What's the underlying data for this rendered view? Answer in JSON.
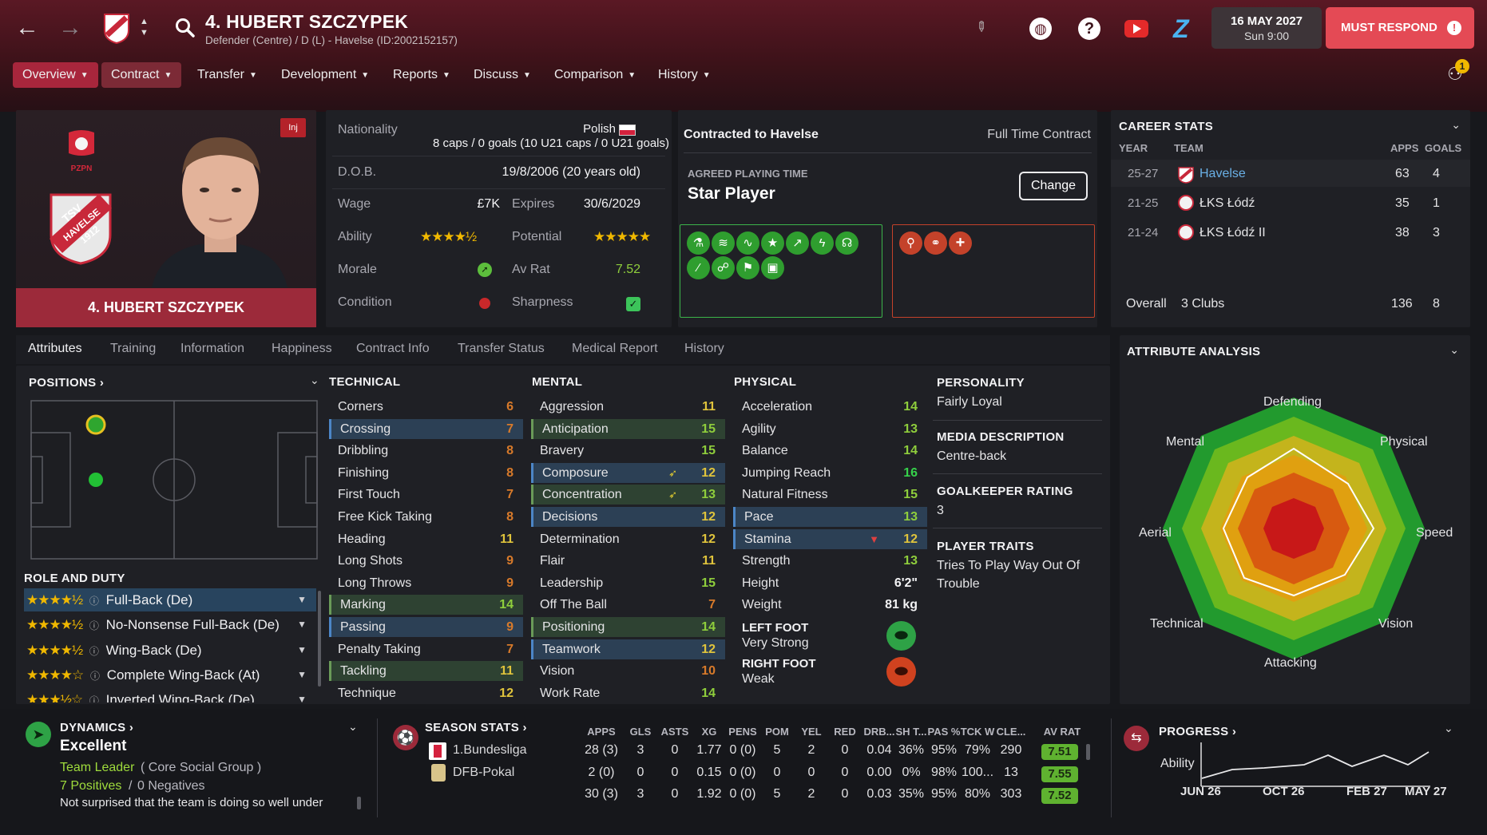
{
  "header": {
    "title": "4. HUBERT SZCZYPEK",
    "subtitle": "Defender (Centre) / D (L) - Havelse (ID:2002152157)",
    "date_line1": "16 MAY 2027",
    "date_line2": "Sun 9:00",
    "must_respond": "MUST RESPOND",
    "notification_count": "1"
  },
  "menu": [
    {
      "label": "Overview"
    },
    {
      "label": "Contract"
    },
    {
      "label": "Transfer"
    },
    {
      "label": "Development"
    },
    {
      "label": "Reports"
    },
    {
      "label": "Discuss"
    },
    {
      "label": "Comparison"
    },
    {
      "label": "History"
    }
  ],
  "profile": {
    "name_plate": "4. HUBERT SZCZYPEK",
    "inj_badge": "Inj",
    "fed_label": "PZPN",
    "club_badge_line1": "TSV",
    "club_badge_line2": "HAVELSE",
    "club_badge_line3": "1912"
  },
  "info": {
    "nationality_label": "Nationality",
    "nationality": "Polish",
    "caps": "8 caps / 0 goals (10 U21 caps / 0 U21 goals)",
    "dob_label": "D.O.B.",
    "dob": "19/8/2006 (20 years old)",
    "wage_label": "Wage",
    "wage": "£7K",
    "expires_label": "Expires",
    "expires": "30/6/2029",
    "ability_label": "Ability",
    "ability_stars": "★★★★½",
    "ability_rating": 4.5,
    "potential_label": "Potential",
    "potential_stars": "★★★★★",
    "potential_rating": 5,
    "morale_label": "Morale",
    "avrat_label": "Av Rat",
    "avrat": "7.52",
    "condition_label": "Condition",
    "sharpness_label": "Sharpness"
  },
  "contract": {
    "title": "Contracted to Havelse",
    "type": "Full Time Contract",
    "playing_time_label": "AGREED PLAYING TIME",
    "playing_time": "Star Player",
    "change_button": "Change"
  },
  "career": {
    "title": "CAREER STATS",
    "headers": [
      "YEAR",
      "TEAM",
      "APPS",
      "GOALS"
    ],
    "rows": [
      {
        "year": "25-27",
        "team": "Havelse",
        "apps": "63",
        "goals": "4"
      },
      {
        "year": "21-25",
        "team": "ŁKS Łódź",
        "apps": "35",
        "goals": "1"
      },
      {
        "year": "21-24",
        "team": "ŁKS Łódź II",
        "apps": "38",
        "goals": "3"
      }
    ],
    "overall_label": "Overall",
    "overall_clubs": "3 Clubs",
    "overall_apps": "136",
    "overall_goals": "8"
  },
  "tabs": [
    "Attributes",
    "Training",
    "Information",
    "Happiness",
    "Contract Info",
    "Transfer Status",
    "Medical Report",
    "History"
  ],
  "positions": {
    "title": "POSITIONS",
    "role_title": "ROLE AND DUTY",
    "roles": [
      {
        "stars": "★★★★½",
        "name": "Full-Back (De)"
      },
      {
        "stars": "★★★★½",
        "name": "No-Nonsense Full-Back (De)"
      },
      {
        "stars": "★★★★½",
        "name": "Wing-Back (De)"
      },
      {
        "stars": "★★★★☆",
        "name": "Complete Wing-Back (At)"
      },
      {
        "stars": "★★★½☆",
        "name": "Inverted Wing-Back (De)"
      }
    ]
  },
  "technical": {
    "title": "TECHNICAL",
    "items": [
      {
        "name": "Corners",
        "value": "6"
      },
      {
        "name": "Crossing",
        "value": "7"
      },
      {
        "name": "Dribbling",
        "value": "8"
      },
      {
        "name": "Finishing",
        "value": "8"
      },
      {
        "name": "First Touch",
        "value": "7"
      },
      {
        "name": "Free Kick Taking",
        "value": "8"
      },
      {
        "name": "Heading",
        "value": "11"
      },
      {
        "name": "Long Shots",
        "value": "9"
      },
      {
        "name": "Long Throws",
        "value": "9"
      },
      {
        "name": "Marking",
        "value": "14"
      },
      {
        "name": "Passing",
        "value": "9"
      },
      {
        "name": "Penalty Taking",
        "value": "7"
      },
      {
        "name": "Tackling",
        "value": "11"
      },
      {
        "name": "Technique",
        "value": "12"
      }
    ]
  },
  "mental": {
    "title": "MENTAL",
    "items": [
      {
        "name": "Aggression",
        "value": "11"
      },
      {
        "name": "Anticipation",
        "value": "15"
      },
      {
        "name": "Bravery",
        "value": "15"
      },
      {
        "name": "Composure",
        "value": "12"
      },
      {
        "name": "Concentration",
        "value": "13"
      },
      {
        "name": "Decisions",
        "value": "12"
      },
      {
        "name": "Determination",
        "value": "12"
      },
      {
        "name": "Flair",
        "value": "11"
      },
      {
        "name": "Leadership",
        "value": "15"
      },
      {
        "name": "Off The Ball",
        "value": "7"
      },
      {
        "name": "Positioning",
        "value": "14"
      },
      {
        "name": "Teamwork",
        "value": "12"
      },
      {
        "name": "Vision",
        "value": "10"
      },
      {
        "name": "Work Rate",
        "value": "14"
      }
    ]
  },
  "physical": {
    "title": "PHYSICAL",
    "items": [
      {
        "name": "Acceleration",
        "value": "14"
      },
      {
        "name": "Agility",
        "value": "13"
      },
      {
        "name": "Balance",
        "value": "14"
      },
      {
        "name": "Jumping Reach",
        "value": "16"
      },
      {
        "name": "Natural Fitness",
        "value": "15"
      },
      {
        "name": "Pace",
        "value": "13"
      },
      {
        "name": "Stamina",
        "value": "12"
      },
      {
        "name": "Strength",
        "value": "13"
      },
      {
        "name": "Height",
        "value": "6'2\""
      },
      {
        "name": "Weight",
        "value": "81 kg"
      }
    ],
    "left_foot_label": "LEFT FOOT",
    "left_foot": "Very Strong",
    "right_foot_label": "RIGHT FOOT",
    "right_foot": "Weak"
  },
  "personality": {
    "personality_label": "PERSONALITY",
    "personality": "Fairly Loyal",
    "media_label": "MEDIA DESCRIPTION",
    "media": "Centre-back",
    "gk_label": "GOALKEEPER RATING",
    "gk": "3",
    "traits_label": "PLAYER TRAITS",
    "traits": "Tries To Play Way Out Of Trouble"
  },
  "analysis": {
    "title": "ATTRIBUTE ANALYSIS",
    "labels": [
      "Defending",
      "Physical",
      "Speed",
      "Vision",
      "Attacking",
      "Technical",
      "Aerial",
      "Mental"
    ]
  },
  "dynamics": {
    "title": "DYNAMICS",
    "rating": "Excellent",
    "role": "Team Leader",
    "group": "( Core Social Group )",
    "positives": "7 Positives",
    "sep": "/",
    "negatives": "0 Negatives",
    "quote": "Not surprised that the team is doing so well under"
  },
  "season": {
    "title": "SEASON STATS",
    "headers": [
      "APPS",
      "GLS",
      "ASTS",
      "XG",
      "PENS",
      "POM",
      "YEL",
      "RED",
      "DRB...",
      "SH T...",
      "PAS %",
      "TCK W",
      "CLE...",
      "AV RAT"
    ],
    "rows": [
      {
        "comp": "1.Bundesliga",
        "cells": [
          "28 (3)",
          "3",
          "0",
          "1.77",
          "0 (0)",
          "5",
          "2",
          "0",
          "0.04",
          "36%",
          "95%",
          "79%",
          "290"
        ],
        "avrat": "7.51"
      },
      {
        "comp": "DFB-Pokal",
        "cells": [
          "2 (0)",
          "0",
          "0",
          "0.15",
          "0 (0)",
          "0",
          "0",
          "0",
          "0.00",
          "0%",
          "98%",
          "100...",
          "13"
        ],
        "avrat": "7.55"
      },
      {
        "comp": "",
        "cells": [
          "30 (3)",
          "3",
          "0",
          "1.92",
          "0 (0)",
          "5",
          "2",
          "0",
          "0.03",
          "35%",
          "95%",
          "80%",
          "303"
        ],
        "avrat": "7.52"
      }
    ]
  },
  "progress": {
    "title": "PROGRESS",
    "y_label": "Ability",
    "x_labels": [
      "JUN 26",
      "OCT 26",
      "FEB 27",
      "MAY 27"
    ]
  }
}
